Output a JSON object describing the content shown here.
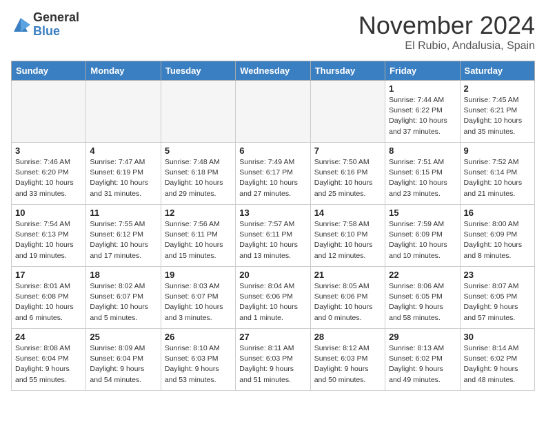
{
  "logo": {
    "general": "General",
    "blue": "Blue"
  },
  "header": {
    "month": "November 2024",
    "location": "El Rubio, Andalusia, Spain"
  },
  "days_of_week": [
    "Sunday",
    "Monday",
    "Tuesday",
    "Wednesday",
    "Thursday",
    "Friday",
    "Saturday"
  ],
  "weeks": [
    [
      {
        "day": "",
        "info": ""
      },
      {
        "day": "",
        "info": ""
      },
      {
        "day": "",
        "info": ""
      },
      {
        "day": "",
        "info": ""
      },
      {
        "day": "",
        "info": ""
      },
      {
        "day": "1",
        "info": "Sunrise: 7:44 AM\nSunset: 6:22 PM\nDaylight: 10 hours\nand 37 minutes."
      },
      {
        "day": "2",
        "info": "Sunrise: 7:45 AM\nSunset: 6:21 PM\nDaylight: 10 hours\nand 35 minutes."
      }
    ],
    [
      {
        "day": "3",
        "info": "Sunrise: 7:46 AM\nSunset: 6:20 PM\nDaylight: 10 hours\nand 33 minutes."
      },
      {
        "day": "4",
        "info": "Sunrise: 7:47 AM\nSunset: 6:19 PM\nDaylight: 10 hours\nand 31 minutes."
      },
      {
        "day": "5",
        "info": "Sunrise: 7:48 AM\nSunset: 6:18 PM\nDaylight: 10 hours\nand 29 minutes."
      },
      {
        "day": "6",
        "info": "Sunrise: 7:49 AM\nSunset: 6:17 PM\nDaylight: 10 hours\nand 27 minutes."
      },
      {
        "day": "7",
        "info": "Sunrise: 7:50 AM\nSunset: 6:16 PM\nDaylight: 10 hours\nand 25 minutes."
      },
      {
        "day": "8",
        "info": "Sunrise: 7:51 AM\nSunset: 6:15 PM\nDaylight: 10 hours\nand 23 minutes."
      },
      {
        "day": "9",
        "info": "Sunrise: 7:52 AM\nSunset: 6:14 PM\nDaylight: 10 hours\nand 21 minutes."
      }
    ],
    [
      {
        "day": "10",
        "info": "Sunrise: 7:54 AM\nSunset: 6:13 PM\nDaylight: 10 hours\nand 19 minutes."
      },
      {
        "day": "11",
        "info": "Sunrise: 7:55 AM\nSunset: 6:12 PM\nDaylight: 10 hours\nand 17 minutes."
      },
      {
        "day": "12",
        "info": "Sunrise: 7:56 AM\nSunset: 6:11 PM\nDaylight: 10 hours\nand 15 minutes."
      },
      {
        "day": "13",
        "info": "Sunrise: 7:57 AM\nSunset: 6:11 PM\nDaylight: 10 hours\nand 13 minutes."
      },
      {
        "day": "14",
        "info": "Sunrise: 7:58 AM\nSunset: 6:10 PM\nDaylight: 10 hours\nand 12 minutes."
      },
      {
        "day": "15",
        "info": "Sunrise: 7:59 AM\nSunset: 6:09 PM\nDaylight: 10 hours\nand 10 minutes."
      },
      {
        "day": "16",
        "info": "Sunrise: 8:00 AM\nSunset: 6:09 PM\nDaylight: 10 hours\nand 8 minutes."
      }
    ],
    [
      {
        "day": "17",
        "info": "Sunrise: 8:01 AM\nSunset: 6:08 PM\nDaylight: 10 hours\nand 6 minutes."
      },
      {
        "day": "18",
        "info": "Sunrise: 8:02 AM\nSunset: 6:07 PM\nDaylight: 10 hours\nand 5 minutes."
      },
      {
        "day": "19",
        "info": "Sunrise: 8:03 AM\nSunset: 6:07 PM\nDaylight: 10 hours\nand 3 minutes."
      },
      {
        "day": "20",
        "info": "Sunrise: 8:04 AM\nSunset: 6:06 PM\nDaylight: 10 hours\nand 1 minute."
      },
      {
        "day": "21",
        "info": "Sunrise: 8:05 AM\nSunset: 6:06 PM\nDaylight: 10 hours\nand 0 minutes."
      },
      {
        "day": "22",
        "info": "Sunrise: 8:06 AM\nSunset: 6:05 PM\nDaylight: 9 hours\nand 58 minutes."
      },
      {
        "day": "23",
        "info": "Sunrise: 8:07 AM\nSunset: 6:05 PM\nDaylight: 9 hours\nand 57 minutes."
      }
    ],
    [
      {
        "day": "24",
        "info": "Sunrise: 8:08 AM\nSunset: 6:04 PM\nDaylight: 9 hours\nand 55 minutes."
      },
      {
        "day": "25",
        "info": "Sunrise: 8:09 AM\nSunset: 6:04 PM\nDaylight: 9 hours\nand 54 minutes."
      },
      {
        "day": "26",
        "info": "Sunrise: 8:10 AM\nSunset: 6:03 PM\nDaylight: 9 hours\nand 53 minutes."
      },
      {
        "day": "27",
        "info": "Sunrise: 8:11 AM\nSunset: 6:03 PM\nDaylight: 9 hours\nand 51 minutes."
      },
      {
        "day": "28",
        "info": "Sunrise: 8:12 AM\nSunset: 6:03 PM\nDaylight: 9 hours\nand 50 minutes."
      },
      {
        "day": "29",
        "info": "Sunrise: 8:13 AM\nSunset: 6:02 PM\nDaylight: 9 hours\nand 49 minutes."
      },
      {
        "day": "30",
        "info": "Sunrise: 8:14 AM\nSunset: 6:02 PM\nDaylight: 9 hours\nand 48 minutes."
      }
    ]
  ]
}
